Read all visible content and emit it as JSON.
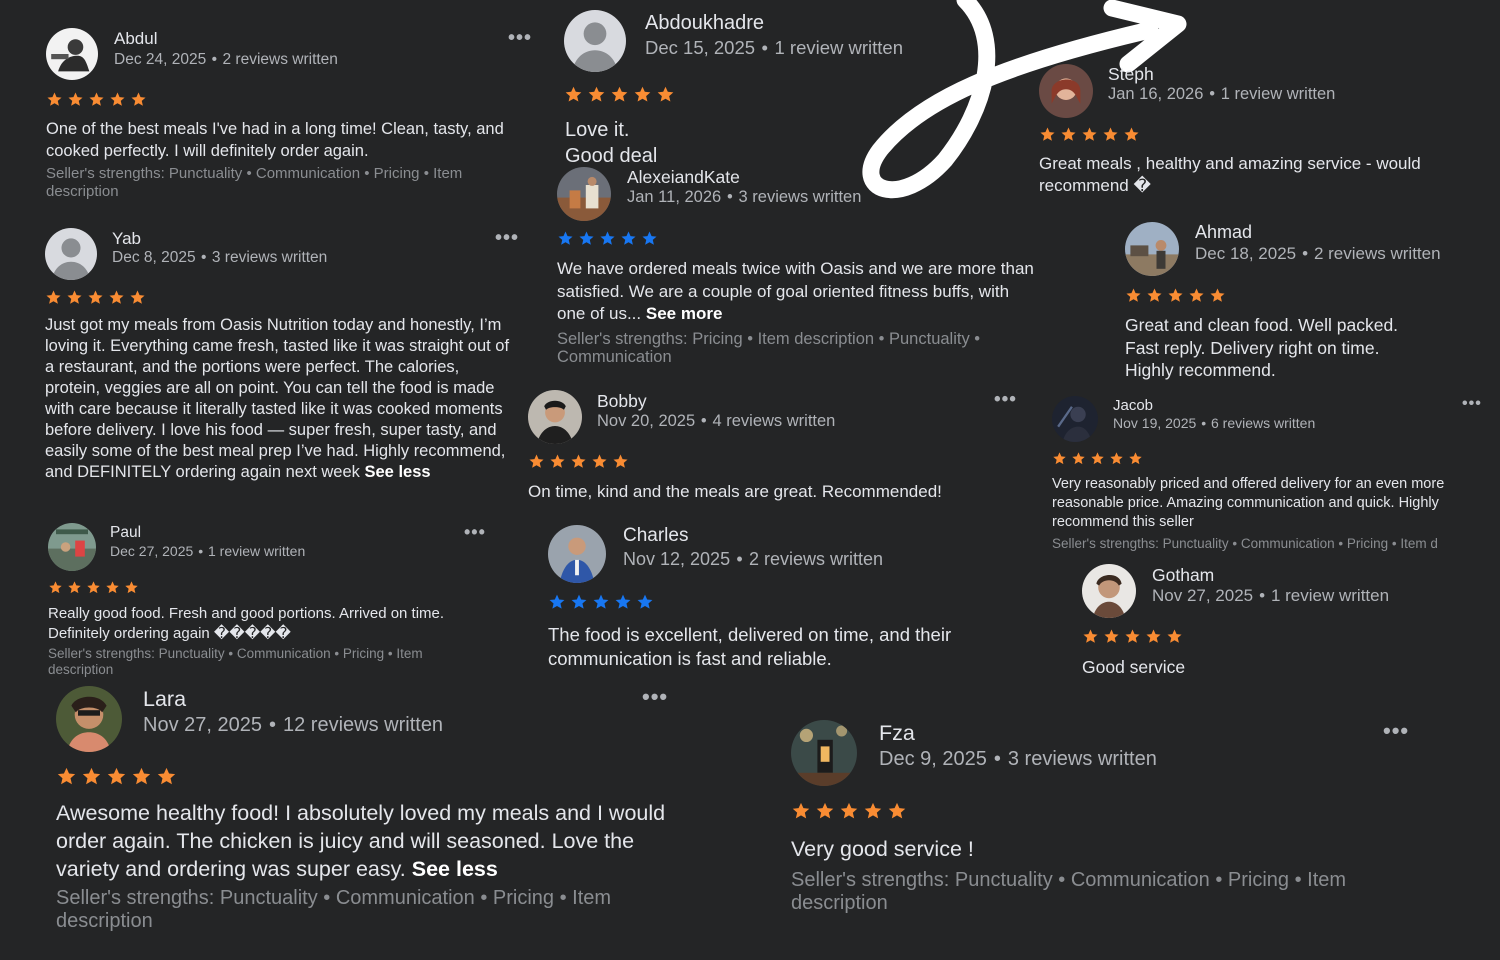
{
  "colors": {
    "bg": "#242526",
    "star_orange": "#f98c33",
    "star_blue": "#1877f2",
    "text": "#e4e6eb",
    "meta": "#b0b3b8",
    "strengths": "#8a8d91"
  },
  "icons": {
    "more": "more-options-icon",
    "star": "star-icon",
    "avatar": "user-avatar-icon",
    "arrow": "curly-arrow-icon"
  },
  "reviews": [
    {
      "name": "Abdul",
      "date": "Dec 24, 2025",
      "count": "2 reviews written",
      "text": "One of the best meals I've had in a long time! Clean, tasty, and cooked perfectly. I will definitely order again.",
      "strengths": "Seller's strengths: Punctuality • Communication • Pricing • Item description",
      "star_color": "orange"
    },
    {
      "name": "Yab",
      "date": "Dec 8, 2025",
      "count": "3 reviews written",
      "text": "Just got my meals from Oasis Nutrition today and honestly, I’m loving it. Everything came fresh, tasted like it was straight out of a restaurant, and the portions were perfect. The calories, protein, veggies are all on point. You can tell the food is made with care because it literally tasted like it was cooked moments before delivery. I love his food — super fresh, super tasty, and easily some of the best meal prep I’ve had. Highly recommend, and DEFINITELY ordering again next week",
      "link": "See less",
      "star_color": "orange"
    },
    {
      "name": "Paul",
      "date": "Dec 27, 2025",
      "count": "1 review written",
      "text": "Really good food. Fresh and good portions. Arrived on time. Definitely ordering again �����",
      "strengths": "Seller's strengths: Punctuality • Communication • Pricing • Item description",
      "star_color": "orange"
    },
    {
      "name": "Lara",
      "date": "Nov 27, 2025",
      "count": "12 reviews written",
      "text": "Awesome healthy food! I absolutely loved my meals and I would order again. The chicken is juicy and will seasoned. Love the variety and ordering was super easy.",
      "link": "See less",
      "strengths": "Seller's strengths: Punctuality • Communication • Pricing • Item description",
      "star_color": "orange"
    },
    {
      "name": "Abdoukhadre",
      "date": "Dec 15, 2025",
      "count": "1 review written",
      "text_line1": "Love it.",
      "text_line2": "Good deal",
      "star_color": "orange"
    },
    {
      "name": "AlexeiandKate",
      "date": "Jan 11, 2026",
      "count": "3 reviews written",
      "text": "We have ordered meals twice with Oasis and we are more than satisfied.  We are a couple of goal  oriented fitness buffs, with one of us...",
      "link": "See more",
      "strengths": "Seller's strengths: Pricing • Item description • Punctuality • Communication",
      "star_color": "blue"
    },
    {
      "name": "Bobby",
      "date": "Nov 20, 2025",
      "count": "4 reviews written",
      "text": "On time, kind and the meals are great. Recommended!",
      "star_color": "orange"
    },
    {
      "name": "Charles",
      "date": "Nov 12, 2025",
      "count": "2 reviews written",
      "text": "The food is excellent, delivered on time, and their communication is fast and reliable.",
      "star_color": "blue"
    },
    {
      "name": "Steph",
      "date": "Jan 16, 2026",
      "count": "1 review written",
      "text": "Great meals , healthy and amazing service - would recommend �",
      "star_color": "orange"
    },
    {
      "name": "Ahmad",
      "date": "Dec 18, 2025",
      "count": "2 reviews written",
      "text_line1": "Great and clean food. Well packed.",
      "text_line2": "Fast reply. Delivery right on time.",
      "text_line3": "Highly recommend.",
      "star_color": "orange"
    },
    {
      "name": "Jacob",
      "date": "Nov 19, 2025",
      "count": "6 reviews written",
      "text": "Very reasonably priced and offered delivery for an even more reasonable price. Amazing communication and quick. Highly recommend this seller",
      "strengths": "Seller's strengths: Punctuality • Communication • Pricing • Item d",
      "star_color": "orange"
    },
    {
      "name": "Gotham",
      "date": "Nov 27, 2025",
      "count": "1 review written",
      "text": "Good service",
      "star_color": "orange"
    },
    {
      "name": "Fza",
      "date": "Dec 9, 2025",
      "count": "3 reviews written",
      "text": "Very good service !",
      "strengths": "Seller's strengths: Punctuality • Communication • Pricing • Item description",
      "star_color": "orange"
    }
  ]
}
